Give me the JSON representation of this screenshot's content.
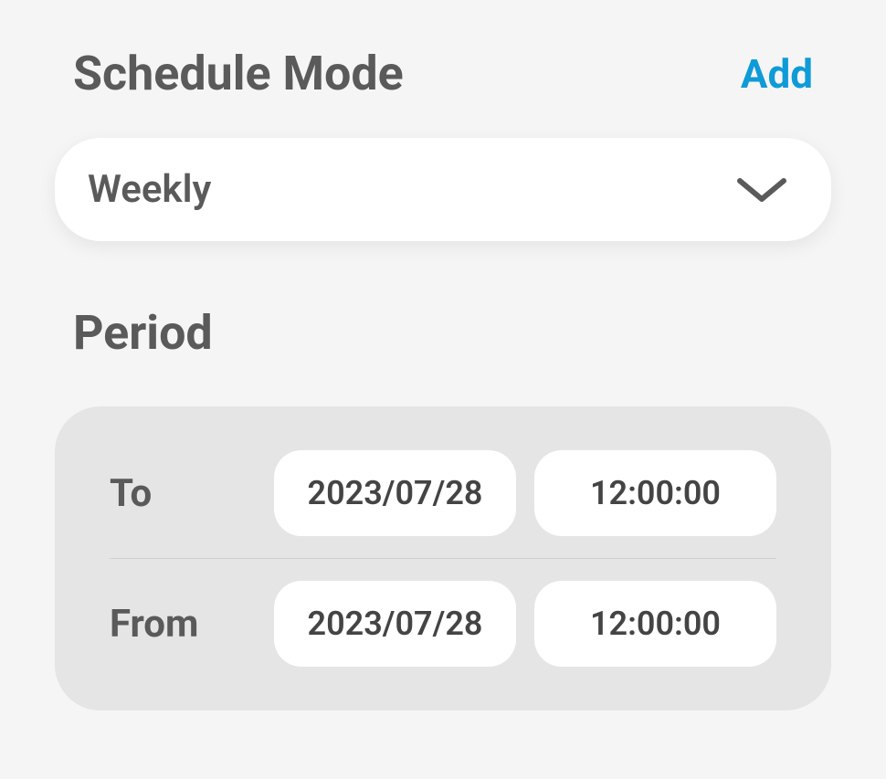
{
  "scheduleMode": {
    "title": "Schedule Mode",
    "addLabel": "Add",
    "selectValue": "Weekly"
  },
  "period": {
    "title": "Period",
    "rows": [
      {
        "label": "To",
        "date": "2023/07/28",
        "time": "12:00:00"
      },
      {
        "label": "From",
        "date": "2023/07/28",
        "time": "12:00:00"
      }
    ]
  }
}
